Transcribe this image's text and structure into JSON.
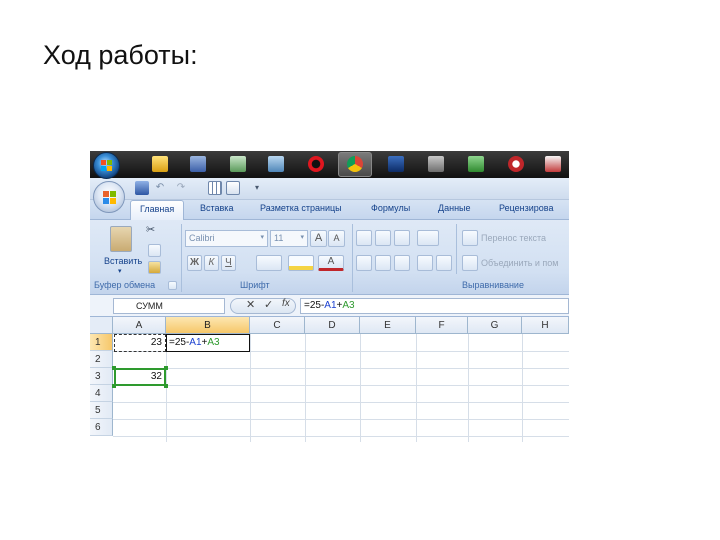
{
  "slide": {
    "title": "Ход работы:"
  },
  "colors": {
    "ribbon_text": "#15428b",
    "group_label": "#3e6aaa",
    "selection_green": "#2e9a2e",
    "a_ref": "#1a3fd0",
    "b_ref": "#2e9a2e"
  },
  "taskbar": {
    "icons": [
      "windows-start-icon",
      "media-player-icon",
      "save-icon",
      "calculator-icon",
      "notebook-icon",
      "opera-icon",
      "chrome-icon",
      "photoshop-icon",
      "tool-icon",
      "tree-icon",
      "skull-icon",
      "book-icon"
    ]
  },
  "ribbon": {
    "tabs": [
      "Главная",
      "Вставка",
      "Разметка страницы",
      "Формулы",
      "Данные",
      "Рецензирова"
    ],
    "clipboard": {
      "paste_label": "Вставить",
      "group_label": "Буфер обмена"
    },
    "font": {
      "name": "Calibri",
      "size": "11",
      "group_label": "Шрифт",
      "bold": "Ж",
      "italic": "К",
      "underline": "Ч",
      "grow": "A",
      "shrink": "A",
      "color": "A"
    },
    "alignment": {
      "wrap_label": "Перенос текста",
      "merge_label": "Объединить и пом",
      "group_label": "Выравнивание"
    }
  },
  "formula_bar": {
    "name_box": "СУММ",
    "cancel": "✕",
    "enter": "✓",
    "fx": "fx",
    "formula_prefix": "=25-",
    "ref_a1": "A1",
    "plus": "+",
    "ref_a3": "A3"
  },
  "grid": {
    "columns": [
      "A",
      "B",
      "C",
      "D",
      "E",
      "F",
      "G",
      "H"
    ],
    "rows": [
      "1",
      "2",
      "3",
      "4",
      "5",
      "6"
    ],
    "a1_value": "23",
    "b1_prefix": "=25-",
    "b1_ref_a1": "A1",
    "b1_plus": "+",
    "b1_ref_a3": "A3",
    "a3_value": "32"
  }
}
